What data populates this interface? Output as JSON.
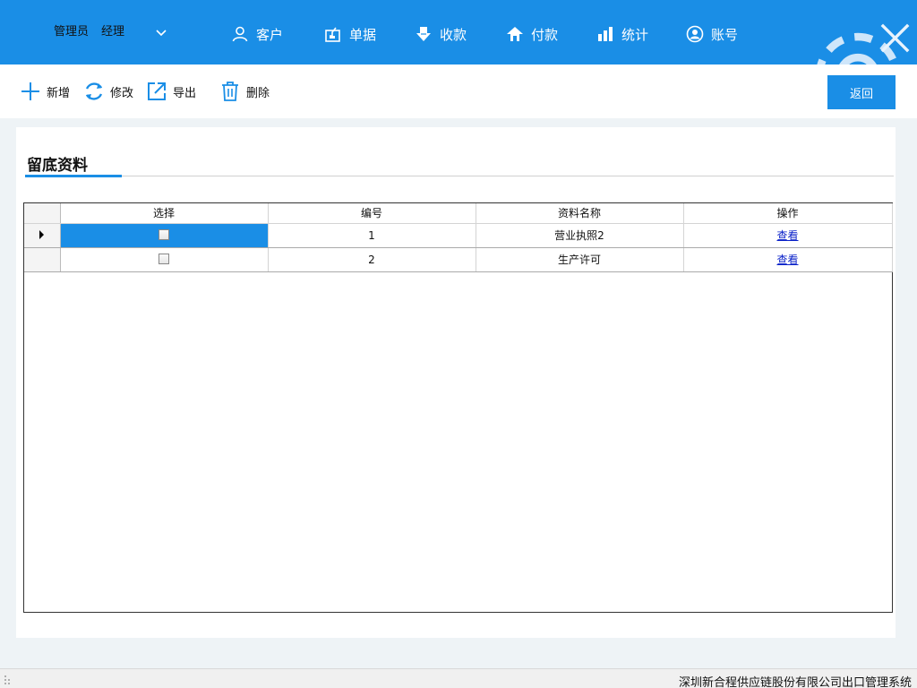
{
  "header": {
    "user_role": "管理员",
    "user_title": "经理",
    "nav": [
      {
        "label": "客户",
        "icon": "user-icon"
      },
      {
        "label": "单据",
        "icon": "document-icon"
      },
      {
        "label": "收款",
        "icon": "download-icon"
      },
      {
        "label": "付款",
        "icon": "upload-icon"
      },
      {
        "label": "统计",
        "icon": "bar-chart-icon"
      },
      {
        "label": "账号",
        "icon": "account-icon"
      }
    ]
  },
  "toolbar": {
    "add_label": "新增",
    "edit_label": "修改",
    "export_label": "导出",
    "delete_label": "删除",
    "back_label": "返回"
  },
  "panel": {
    "title": "留底资料"
  },
  "table": {
    "columns": [
      "选择",
      "编号",
      "资料名称",
      "操作"
    ],
    "rows": [
      {
        "id": "1",
        "name": "营业执照2",
        "action": "查看",
        "checked": false
      },
      {
        "id": "2",
        "name": "生产许可",
        "action": "查看",
        "checked": false
      }
    ]
  },
  "status": {
    "text": "深圳新合程供应链股份有限公司出口管理系统"
  },
  "colors": {
    "brand": "#1a8ee6",
    "link": "#0b22c9"
  }
}
